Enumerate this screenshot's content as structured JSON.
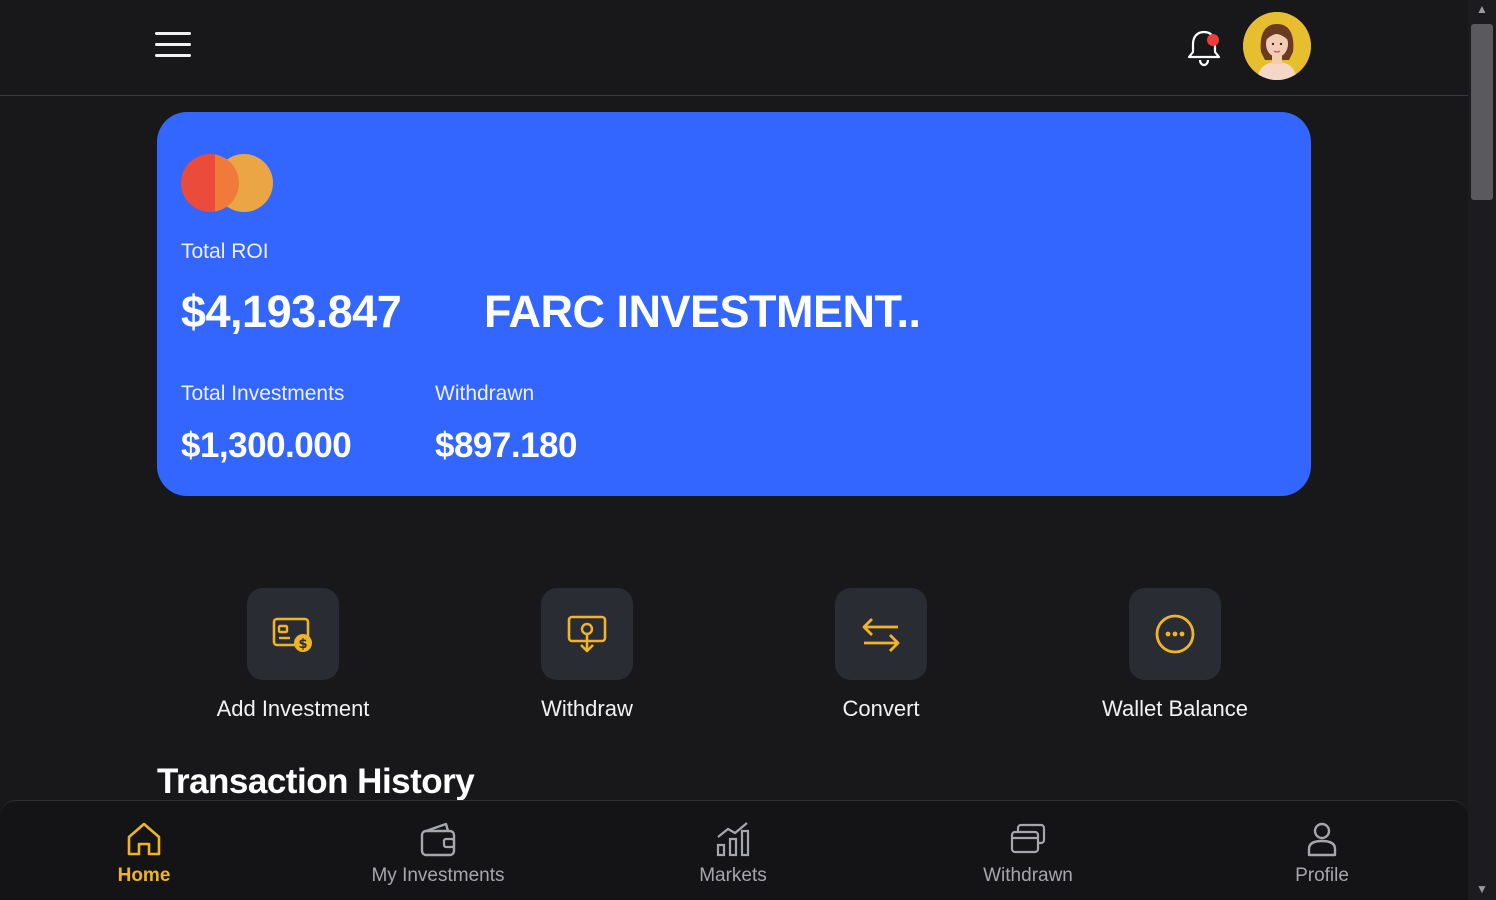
{
  "header": {
    "menu_icon": "hamburger-menu-icon",
    "notification_icon": "bell-icon",
    "avatar_icon": "user-avatar"
  },
  "card": {
    "logo": "mastercard-logo",
    "roi_label": "Total ROI",
    "roi_value": "$4,193.847",
    "company": "FARC INVESTMENT..",
    "investments_label": "Total Investments",
    "investments_value": "$1,300.000",
    "withdrawn_label": "Withdrawn",
    "withdrawn_value": "$897.180",
    "colors": {
      "card": "#3366ff",
      "mc_red": "#eb4b3b",
      "mc_orange": "#f7a93a"
    }
  },
  "actions": [
    {
      "label": "Add Investment",
      "icon": "add-investment-icon"
    },
    {
      "label": "Withdraw",
      "icon": "withdraw-icon"
    },
    {
      "label": "Convert",
      "icon": "convert-arrows-icon"
    },
    {
      "label": "Wallet Balance",
      "icon": "wallet-balance-icon"
    }
  ],
  "section": {
    "title": "Transaction History"
  },
  "nav": [
    {
      "label": "Home",
      "icon": "home-icon",
      "active": true
    },
    {
      "label": "My Investments",
      "icon": "wallet-icon",
      "active": false
    },
    {
      "label": "Markets",
      "icon": "markets-chart-icon",
      "active": false
    },
    {
      "label": "Withdrawn",
      "icon": "cards-icon",
      "active": false
    },
    {
      "label": "Profile",
      "icon": "profile-icon",
      "active": false
    }
  ],
  "colors": {
    "accent": "#f0b429",
    "background": "#18181b",
    "tile": "#2a2c34"
  }
}
